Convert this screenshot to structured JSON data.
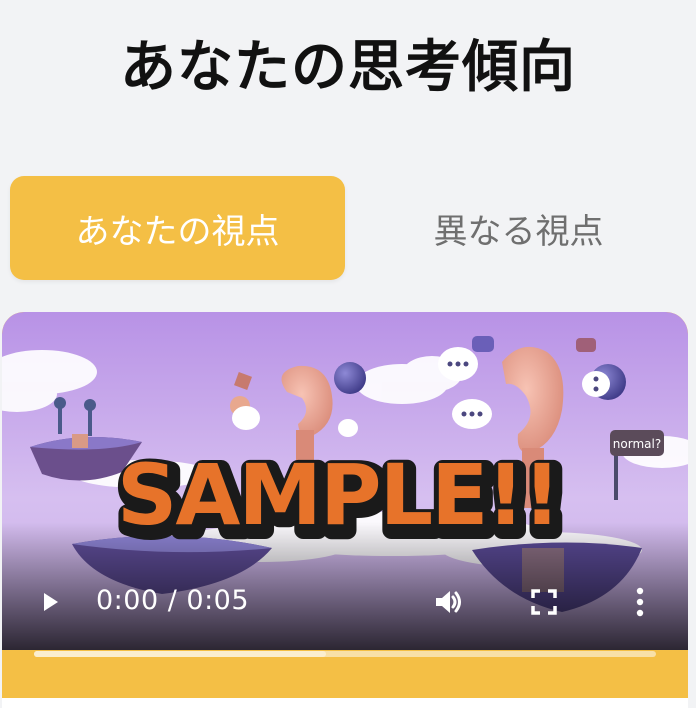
{
  "header": {
    "title": "あなたの思考傾向"
  },
  "tabs": [
    {
      "label": "あなたの視点",
      "active": true
    },
    {
      "label": "異なる視点",
      "active": false
    }
  ],
  "video": {
    "overlay_text": "SAMPLE!!",
    "sign_text": "normal?",
    "current_time": "0:00",
    "duration": "0:05",
    "time_separator": " / ",
    "buffered_fraction": 0.47,
    "icons": {
      "play": "play-icon",
      "volume": "volume-icon",
      "fullscreen": "fullscreen-icon",
      "more": "more-options-icon"
    }
  },
  "colors": {
    "accent": "#f4bf45",
    "background": "#f2f3f5",
    "overlay_orange": "#e7732a",
    "sky_purple": "#c9a8ea"
  }
}
